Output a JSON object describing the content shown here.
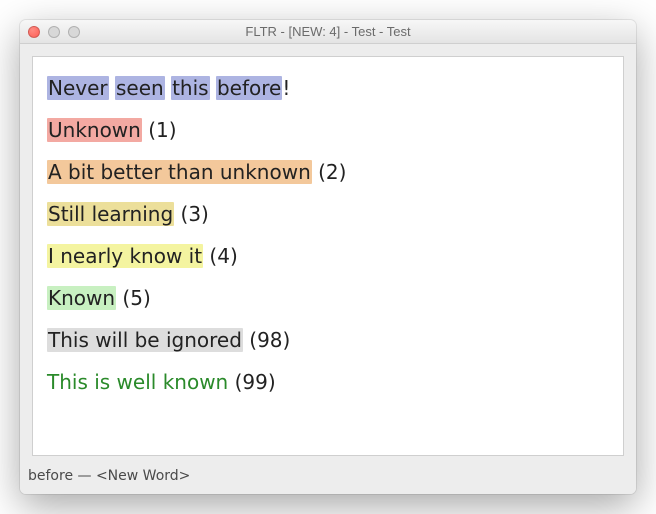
{
  "window": {
    "title": "FLTR - [NEW: 4] - Test - Test"
  },
  "lines": {
    "l0": {
      "w0": "Never",
      "w1": "seen",
      "w2": "this",
      "w3": "before",
      "punct": "!"
    },
    "l1": {
      "text": "Unknown",
      "suffix": " (1)"
    },
    "l2": {
      "text": "A bit better than unknown",
      "suffix": " (2)"
    },
    "l3": {
      "text": "Still learning",
      "suffix": " (3)"
    },
    "l4": {
      "text": "I nearly know it",
      "suffix": " (4)"
    },
    "l5": {
      "text": "Known",
      "suffix": " (5)"
    },
    "l6": {
      "text": "This will be ignored",
      "suffix": " (98)"
    },
    "l7": {
      "text": "This is well known",
      "suffix": " (99)"
    }
  },
  "status": {
    "text": "before — <New Word>"
  }
}
